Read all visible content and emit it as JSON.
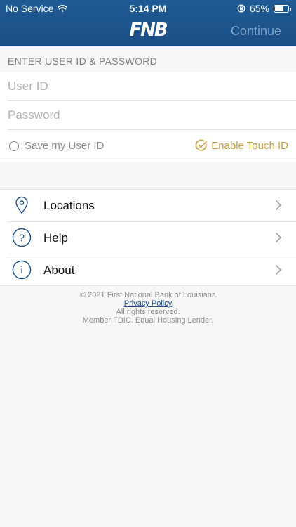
{
  "status_bar": {
    "carrier": "No Service",
    "time": "5:14 PM",
    "battery_percent": "65%",
    "battery_level": 0.65
  },
  "header": {
    "logo_text": "FNB",
    "continue_label": "Continue"
  },
  "login": {
    "section_title": "ENTER USER ID & PASSWORD",
    "user_id_placeholder": "User ID",
    "password_placeholder": "Password",
    "save_user_id_label": "Save my User ID",
    "touch_id_label": "Enable Touch ID"
  },
  "menu": {
    "items": [
      {
        "label": "Locations",
        "icon": "location-pin-icon"
      },
      {
        "label": "Help",
        "icon": "question-circle-icon"
      },
      {
        "label": "About",
        "icon": "info-circle-icon"
      }
    ]
  },
  "footer": {
    "copyright": "© 2021 First National Bank of Louisiana",
    "privacy_link": "Privacy Policy",
    "rights": "All rights reserved.",
    "member": "Member FDIC. Equal Housing Lender."
  },
  "colors": {
    "brand_blue": "#1b4f85",
    "gold_accent": "#c4a23e",
    "muted_continue": "#7aa1c8"
  }
}
